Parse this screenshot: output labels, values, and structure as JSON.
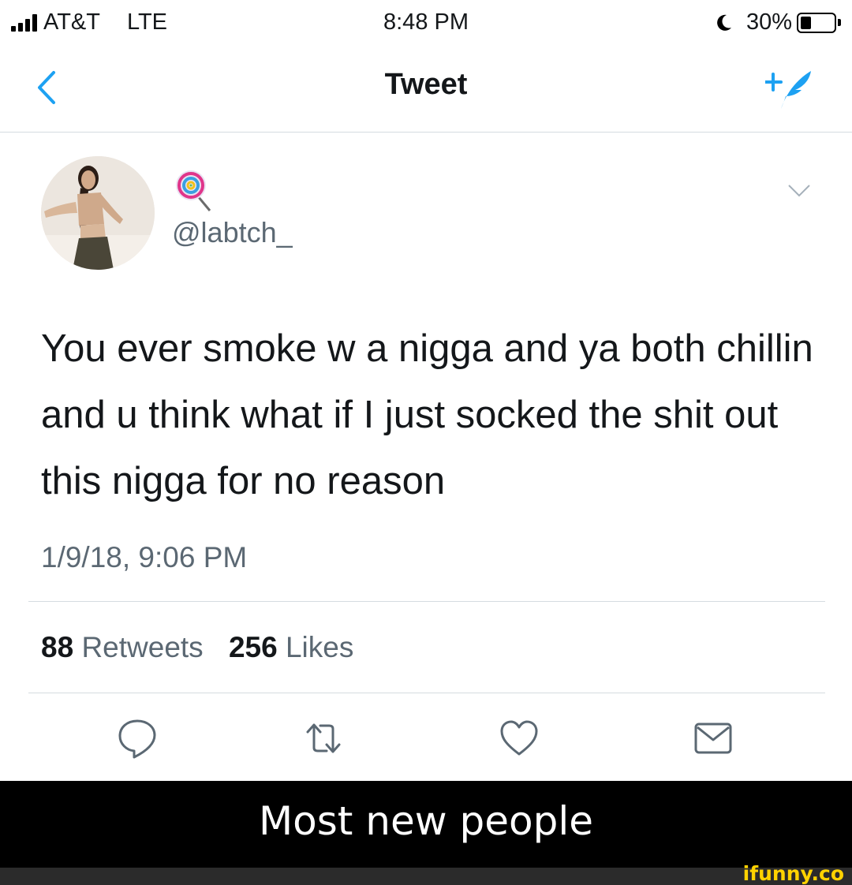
{
  "status_bar": {
    "carrier": "AT&T",
    "network": "LTE",
    "time": "8:48 PM",
    "battery": "30%",
    "battery_level": 0.3
  },
  "nav": {
    "title": "Tweet"
  },
  "tweet": {
    "display_name_icon": "lollipop-emoji",
    "handle": "@labtch_",
    "text": "You ever smoke w a nigga and ya both chillin and u think what if I just socked the shit out this nigga for no reason",
    "timestamp": "1/9/18, 9:06 PM",
    "retweets_count": "88",
    "retweets_label": "Retweets",
    "likes_count": "256",
    "likes_label": "Likes"
  },
  "actions": [
    "reply-icon",
    "retweet-icon",
    "like-icon",
    "message-icon"
  ],
  "caption": "Most new people",
  "watermark": "ifunny.co",
  "colors": {
    "accent": "#1da1f2",
    "text": "#14171a",
    "secondary": "#5b6873",
    "caption_bg": "#000000",
    "watermark": "#ffd200"
  }
}
